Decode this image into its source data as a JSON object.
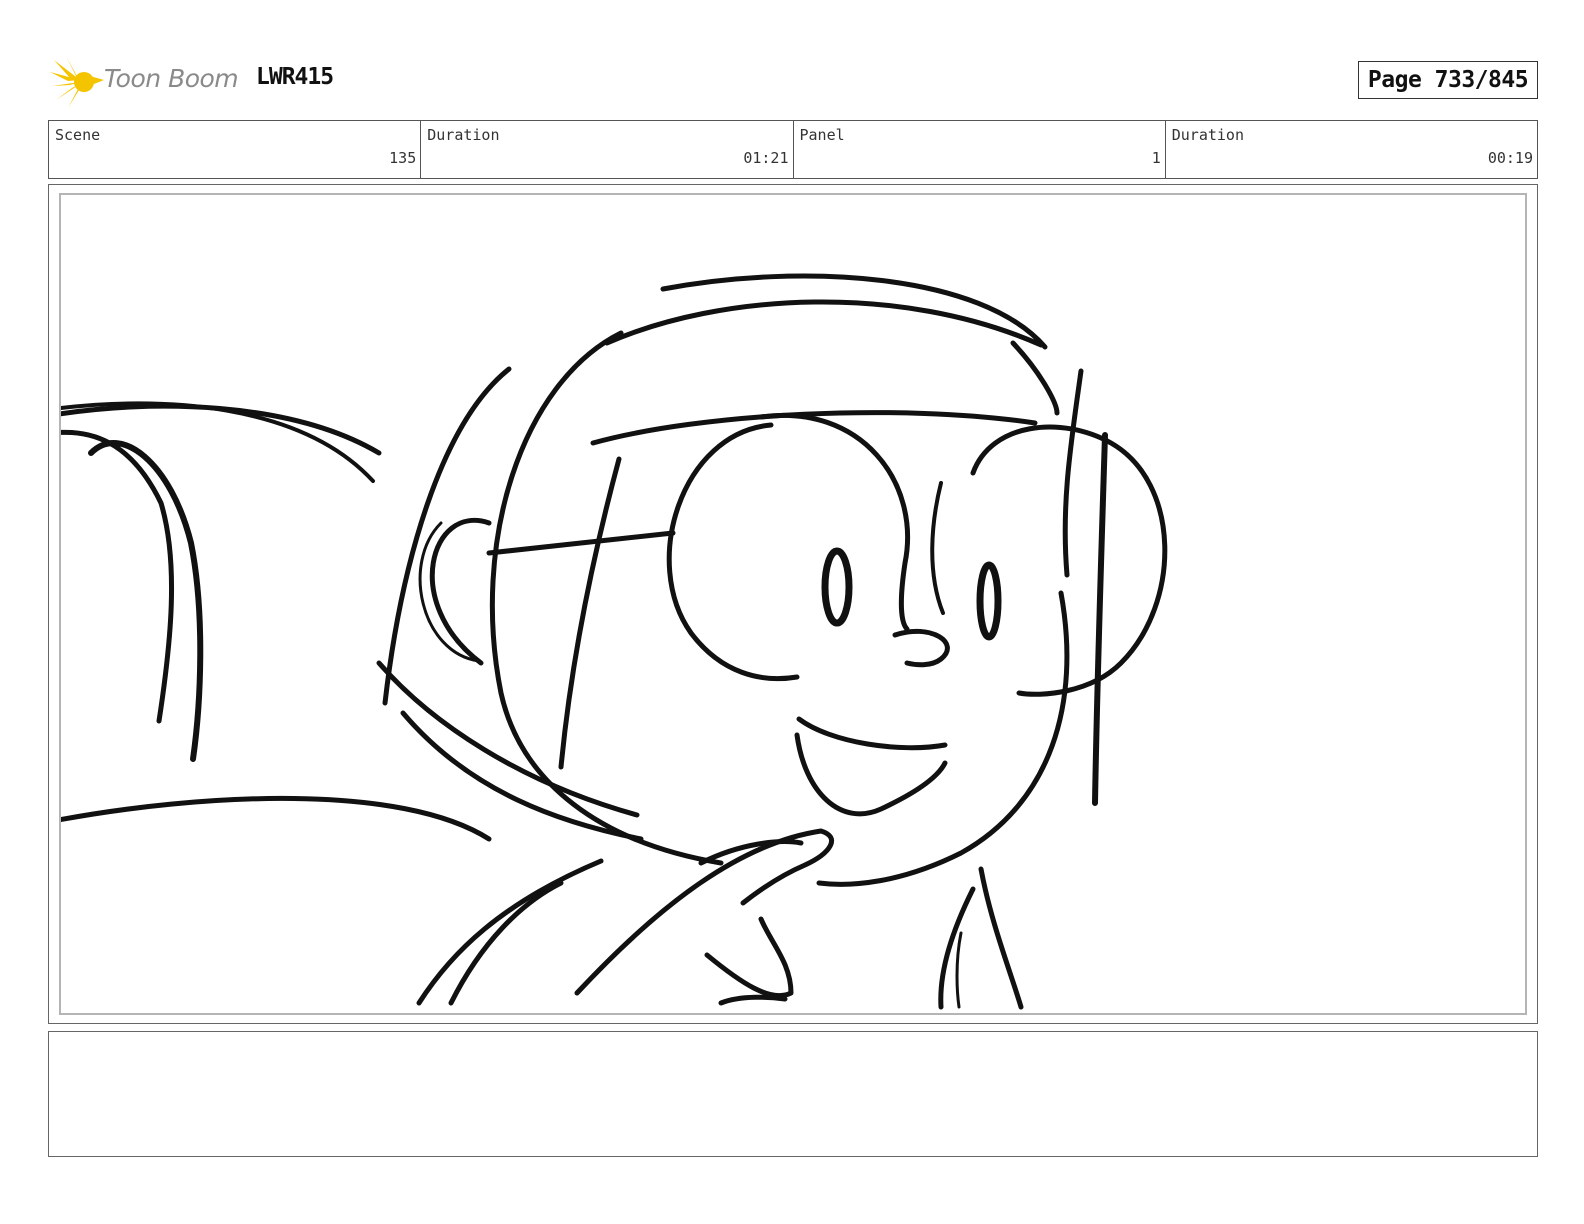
{
  "header": {
    "logo_text": "Toon Boom",
    "project_code": "LWR415",
    "page_counter": "Page 733/845"
  },
  "info": {
    "scene_label": "Scene",
    "scene_value": "135",
    "scene_duration_label": "Duration",
    "scene_duration_value": "01:21",
    "panel_label": "Panel",
    "panel_value": "1",
    "panel_duration_label": "Duration",
    "panel_duration_value": "00:19"
  },
  "panel": {
    "drawing": "sketch-character-drawing"
  },
  "notes": {
    "text": ""
  },
  "colors": {
    "logo_star": "#f5c400",
    "logo_text": "#8a8a8a",
    "ink": "#111111",
    "frame_inner": "#b5b5b5"
  }
}
